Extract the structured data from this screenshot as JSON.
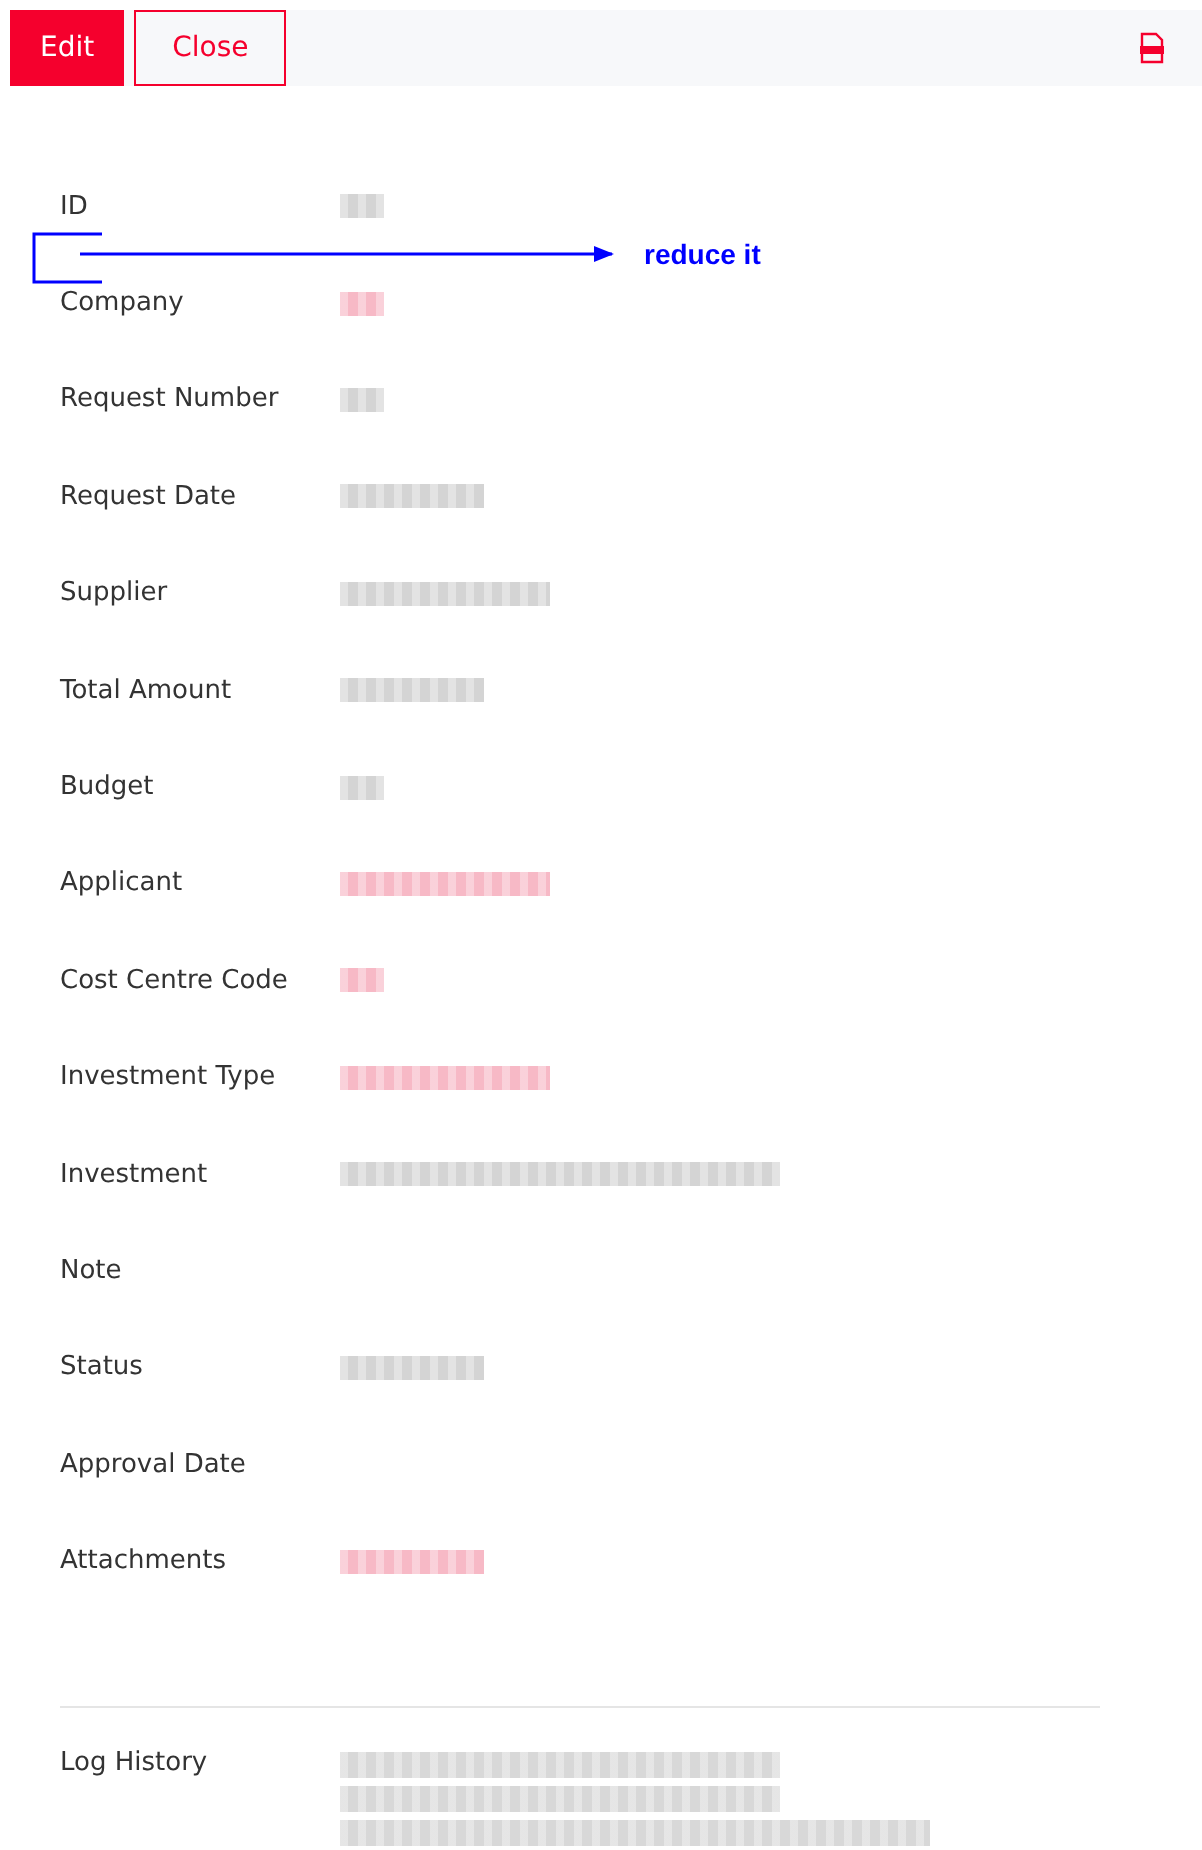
{
  "toolbar": {
    "buttons": [
      {
        "label": "Edit",
        "kind": "primary"
      },
      {
        "label": "Close",
        "kind": "outline"
      }
    ]
  },
  "fields": [
    {
      "label": "ID",
      "value": {
        "kind": "blur_short",
        "color": "#d4d4d4"
      }
    },
    {
      "label": "Company",
      "value": {
        "kind": "blur_short",
        "color": "#f7b9c6"
      }
    },
    {
      "label": "Request Number",
      "value": {
        "kind": "blur_short",
        "color": "#d4d4d4"
      }
    },
    {
      "label": "Request Date",
      "value": {
        "kind": "blur_medium",
        "color": "#d4d4d4"
      }
    },
    {
      "label": "Supplier",
      "value": {
        "kind": "blur_long",
        "color": "#d4d4d4"
      }
    },
    {
      "label": "Total Amount",
      "value": {
        "kind": "blur_medium",
        "color": "#d4d4d4"
      }
    },
    {
      "label": "Budget",
      "value": {
        "kind": "blur_short",
        "color": "#d4d4d4"
      }
    },
    {
      "label": "Applicant",
      "value": {
        "kind": "blur_long",
        "color": "#f7b9c6"
      }
    },
    {
      "label": "Cost Centre Code",
      "value": {
        "kind": "blur_short",
        "color": "#f7b9c6"
      }
    },
    {
      "label": "Investment Type",
      "value": {
        "kind": "blur_long",
        "color": "#f7b9c6"
      }
    },
    {
      "label": "Investment",
      "value": {
        "kind": "blur_xlong",
        "color": "#d4d4d4"
      }
    },
    {
      "label": "Note"
    },
    {
      "label": "Status",
      "value": {
        "kind": "blur_medium",
        "color": "#d4d4d4"
      }
    },
    {
      "label": "Approval Date"
    },
    {
      "label": "Attachments",
      "value": {
        "kind": "blur_medium",
        "color": "#f7b9c6"
      }
    }
  ],
  "log_history": {
    "label": "Log History",
    "lines": [
      {
        "kind": "blur_xlong"
      },
      {
        "kind": "blur_xlong"
      },
      {
        "kind": "blur_xxlong"
      }
    ]
  },
  "annotation": {
    "text": "reduce it"
  }
}
